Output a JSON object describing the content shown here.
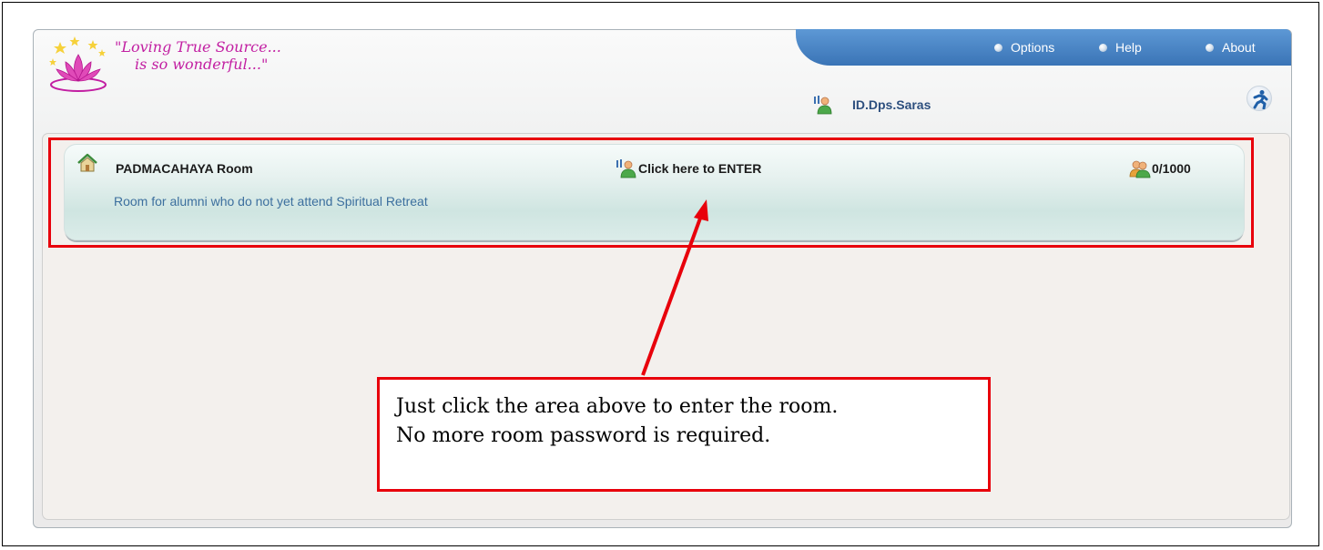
{
  "app": {
    "slogan_line1": "\"Loving True Source...",
    "slogan_line2": "is so wonderful...\""
  },
  "menu": [
    {
      "label": "Options",
      "icon": "bullet-icon"
    },
    {
      "label": "Help",
      "icon": "bullet-icon"
    },
    {
      "label": "About",
      "icon": "bullet-icon"
    }
  ],
  "user": {
    "name": "ID.Dps.Saras",
    "icon": "user-status-icon"
  },
  "room": {
    "name": "PADMACAHAYA Room",
    "description": "Room for alumni who do not yet attend Spiritual Retreat",
    "enter_label": "Click here to ENTER",
    "occupancy": "0/1000",
    "icon": "room-house-icon"
  },
  "annotation": {
    "line1": "Just click the area above to enter the room.",
    "line2": "No more room password is required."
  },
  "colors": {
    "accent_blue": "#3a74b6",
    "slogan_pink": "#c21fa2",
    "annotation_red": "#e8000b",
    "description_blue": "#3c6f9e"
  }
}
